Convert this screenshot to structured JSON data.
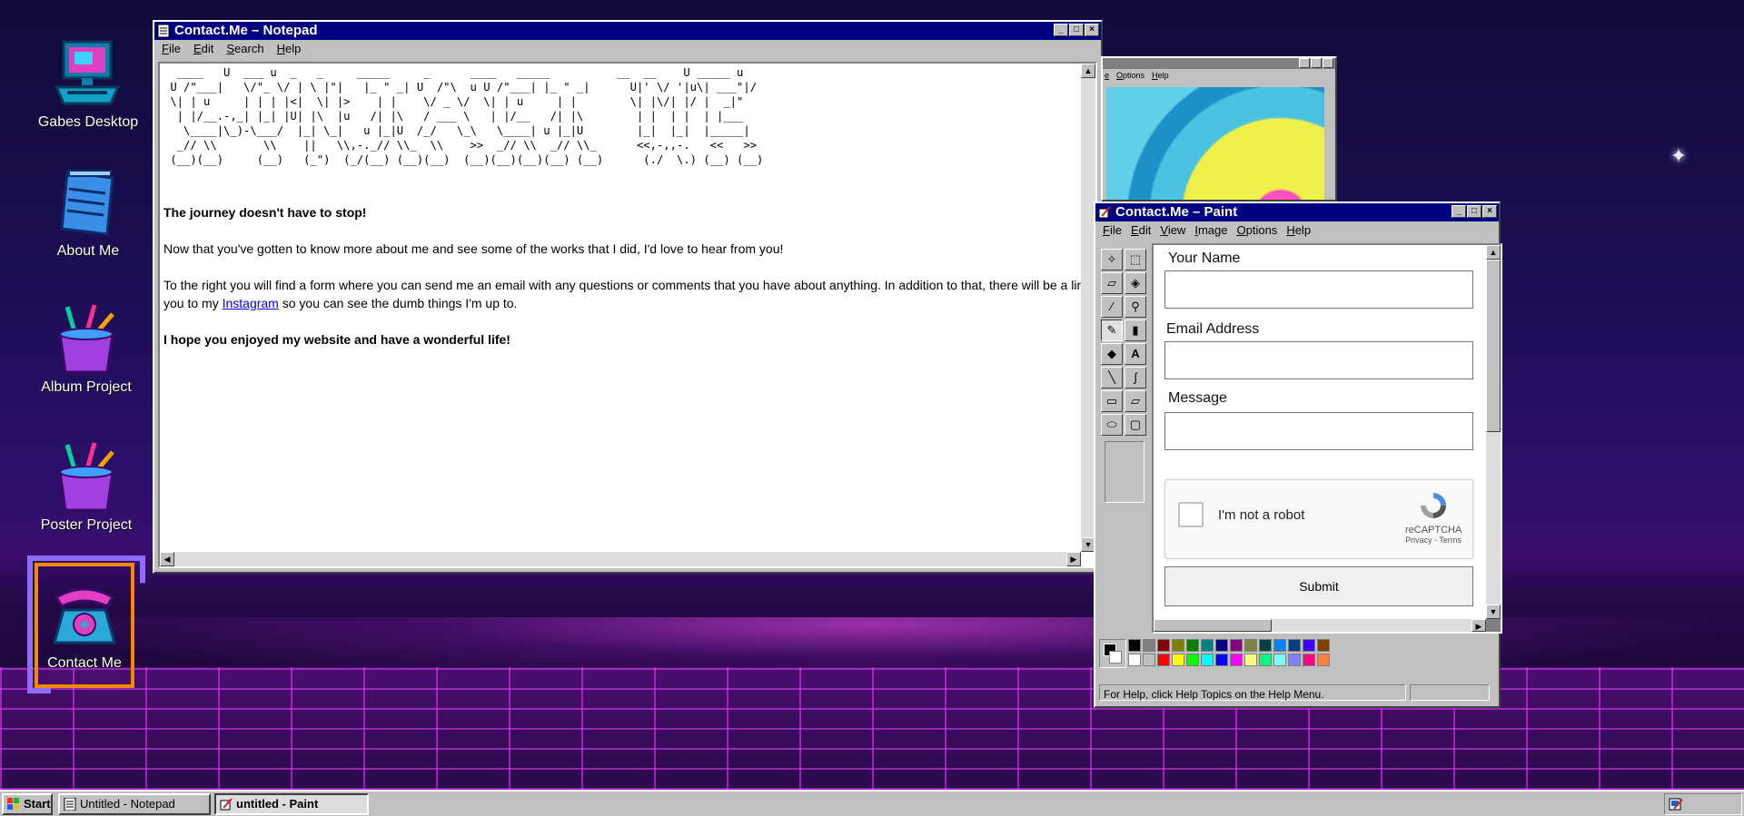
{
  "desktop": {
    "icons": [
      {
        "label": "Gabes Desktop",
        "icon": "computer-icon"
      },
      {
        "label": "About Me",
        "icon": "notepad-icon"
      },
      {
        "label": "Album Project",
        "icon": "paint-cup-icon"
      },
      {
        "label": "Poster Project",
        "icon": "paint-cup-icon"
      },
      {
        "label": "Contact Me",
        "icon": "telephone-icon"
      }
    ],
    "selected_icon": "Contact Me"
  },
  "notepad": {
    "title": "Contact.Me – Notepad",
    "menu": [
      "File",
      "Edit",
      "Search",
      "Help"
    ],
    "ascii_art": "  ____   U  ___ u  _   _     _____     _      ____   _____          __  __    U _____ u\n U /\"___|   \\/\"_ \\/ | \\ |\"|   |_ \" _| U  /\"\\  u U /\"___| |_ \" _|      U|' \\/ '|u\\| ___\"|/\n \\| | u     | | | |<|  \\| |>    | |    \\/ _ \\/  \\| | u     | |        \\| |\\/| |/ |  _|\"\n  | |/__.-,_| |_| |U| |\\  |u   /| |\\   / ___ \\   | |/__   /| |\\        | |  | |  | |___\n   \\____|\\_)-\\___/  |_| \\_|   u |_|U  /_/   \\_\\   \\____| u |_|U        |_|  |_|  |_____|\n  _// \\\\       \\\\    ||   \\\\,-._// \\\\_  \\\\    >>  _// \\\\  _// \\\\_      <<,-,,-.   <<   >>\n (__)(__)     (__)   (_\")  (_/(__) (__)(__)  (__)(__)(__)(__) (__)      (./  \\.) (__) (__)",
    "paragraphs": {
      "heading": "The journey doesn't have to stop!",
      "p1": "Now that you've gotten to know more about me and see some of the works that I did, I'd love to hear from you!",
      "p2_before": "To the right you will find a form where you can send me an email with any questions or comments that you have about anything. In addition to that, there will be a link attached that will take you to my ",
      "p2_link": "Instagram",
      "p2_after": " so you can see the dumb things I'm up to.",
      "closing": "I hope you enjoyed my website and have a wonderful life!"
    }
  },
  "paint_small": {
    "menu": [
      "e",
      "Options",
      "Help"
    ]
  },
  "paint": {
    "title": "Contact.Me – Paint",
    "menu": [
      "File",
      "Edit",
      "View",
      "Image",
      "Options",
      "Help"
    ],
    "form": {
      "name_label": "Your Name",
      "email_label": "Email Address",
      "message_label": "Message",
      "name_value": "",
      "email_value": "",
      "message_value": "",
      "captcha_text": "I'm not a robot",
      "captcha_brand": "reCAPTCHA",
      "captcha_links": "Privacy - Terms",
      "submit_label": "Submit"
    },
    "palette_colors": [
      "#000000",
      "#808080",
      "#800000",
      "#808000",
      "#008000",
      "#008080",
      "#000080",
      "#800080",
      "#808040",
      "#004040",
      "#0080ff",
      "#004080",
      "#4000ff",
      "#804000",
      "#ffffff",
      "#c0c0c0",
      "#ff0000",
      "#ffff00",
      "#00ff00",
      "#00ffff",
      "#0000ff",
      "#ff00ff",
      "#ffff80",
      "#00ff80",
      "#80ffff",
      "#8080ff",
      "#ff0080",
      "#ff8040"
    ],
    "status_text": "For Help, click Help Topics on the Help Menu."
  },
  "taskbar": {
    "start_label": "Start",
    "tasks": [
      {
        "label": "Untitled - Notepad",
        "active": false
      },
      {
        "label": "untitled - Paint",
        "active": true
      }
    ]
  }
}
